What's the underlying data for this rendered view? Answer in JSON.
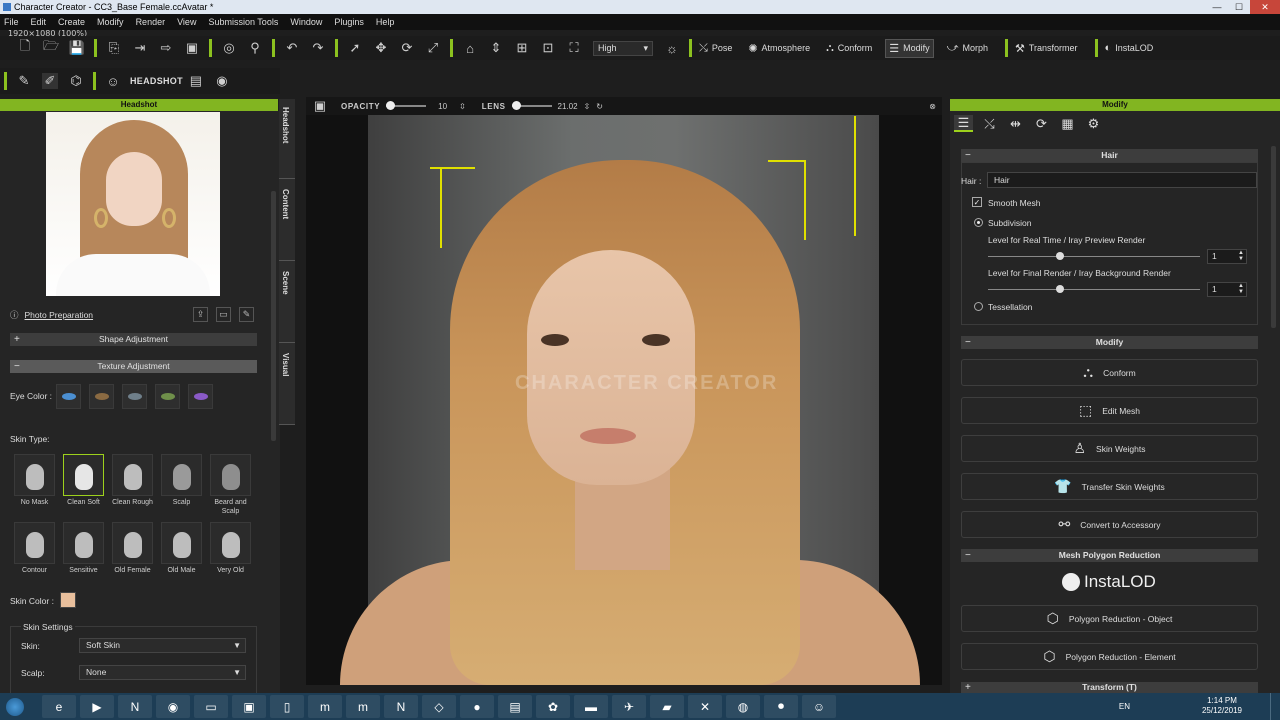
{
  "window": {
    "title": "Character Creator - CC3_Base Female.ccAvatar *",
    "minimize": "—",
    "maximize": "☐",
    "close": "✕"
  },
  "menu": [
    "File",
    "Edit",
    "Create",
    "Modify",
    "Render",
    "View",
    "Submission Tools",
    "Window",
    "Plugins",
    "Help"
  ],
  "resolution": "1920×1080 (100%)",
  "toolbar": {
    "quality": "High",
    "pose": "Pose",
    "atmosphere": "Atmosphere",
    "conform": "Conform",
    "modify": "Modify",
    "morph": "Morph",
    "transformer": "Transformer",
    "instalod": "InstaLOD"
  },
  "toolbar2": {
    "headshot": "HEADSHOT"
  },
  "left_panel": {
    "header": "Headshot",
    "photo_preparation": "Photo Preparation",
    "shape_adjustment": "Shape Adjustment",
    "texture_adjustment": "Texture Adjustment",
    "eye_color_label": "Eye Color :",
    "eye_colors": [
      "#4b8fd1",
      "#8a6a42",
      "#6f7f8a",
      "#6f8f4a",
      "#8a5ac7"
    ],
    "skin_type_label": "Skin Type:",
    "skin_types": [
      {
        "label": "No Mask"
      },
      {
        "label": "Clean Soft"
      },
      {
        "label": "Clean Rough"
      },
      {
        "label": "Scalp"
      },
      {
        "label": "Beard and Scalp"
      },
      {
        "label": "Contour"
      },
      {
        "label": "Sensitive"
      },
      {
        "label": "Old Female"
      },
      {
        "label": "Old Male"
      },
      {
        "label": "Very Old"
      }
    ],
    "skin_color_label": "Skin Color :",
    "skin_settings": "Skin Settings",
    "skin_label": "Skin:",
    "skin_value": "Soft Skin",
    "scalp_label": "Scalp:",
    "scalp_value": "None"
  },
  "side_tabs": [
    "Headshot",
    "Content",
    "Scene",
    "Visual"
  ],
  "viewport": {
    "opacity_label": "OPACITY",
    "opacity_value": "10",
    "lens_label": "LENS",
    "lens_value": "21.02",
    "watermark": "CHARACTER CREATOR"
  },
  "right_panel": {
    "header": "Modify",
    "hair_section": "Hair",
    "hair_label": "Hair :",
    "hair_value": "Hair",
    "smooth_mesh": "Smooth Mesh",
    "subdivision": "Subdivision",
    "realtime_level_label": "Level for Real Time / Iray Preview Render",
    "realtime_level_value": "1",
    "final_level_label": "Level for Final Render / Iray Background Render",
    "final_level_value": "1",
    "tessellation": "Tessellation",
    "modify_section": "Modify",
    "buttons": {
      "conform": "Conform",
      "edit_mesh": "Edit Mesh",
      "skin_weights": "Skin Weights",
      "transfer_skin_weights": "Transfer Skin Weights",
      "convert_to_accessory": "Convert to Accessory"
    },
    "mesh_polygon_reduction": "Mesh Polygon Reduction",
    "instalod_logo": "InstaLOD",
    "polygon_reduction_object": "Polygon Reduction - Object",
    "polygon_reduction_element": "Polygon Reduction - Element",
    "transform": "Transform  (T)"
  },
  "taskbar": {
    "lang": "EN",
    "time": "1:14 PM",
    "date": "25/12/2019"
  }
}
